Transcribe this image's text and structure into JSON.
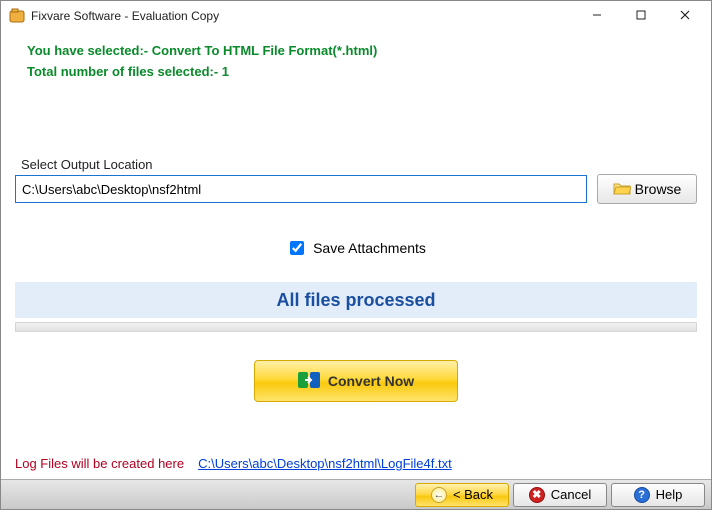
{
  "window": {
    "title": "Fixvare Software - Evaluation Copy"
  },
  "messages": {
    "selected_format": "You have selected:-  Convert To HTML File Format(*.html)",
    "file_count": "Total number of files selected:- 1"
  },
  "output": {
    "label": "Select Output Location",
    "path": "C:\\Users\\abc\\Desktop\\nsf2html",
    "browse": "Browse"
  },
  "options": {
    "save_attachments": "Save Attachments",
    "save_attachments_checked": true
  },
  "status": {
    "text": "All files processed"
  },
  "actions": {
    "convert": "Convert Now"
  },
  "log": {
    "label": "Log Files will be created here",
    "link": "C:\\Users\\abc\\Desktop\\nsf2html\\LogFile4f.txt"
  },
  "footer": {
    "back": "< Back",
    "cancel": "Cancel",
    "help": "Help"
  }
}
